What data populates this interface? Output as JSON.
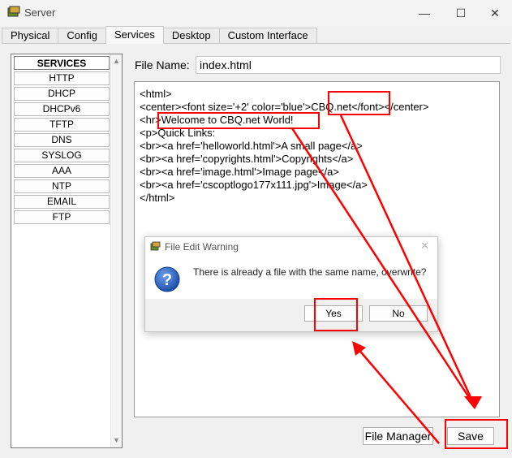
{
  "window": {
    "title": "Server",
    "controls": [
      "—",
      "☐",
      "✕"
    ]
  },
  "tabs": [
    {
      "label": "Physical",
      "active": false
    },
    {
      "label": "Config",
      "active": false
    },
    {
      "label": "Services",
      "active": true
    },
    {
      "label": "Desktop",
      "active": false
    },
    {
      "label": "Custom Interface",
      "active": false
    }
  ],
  "services": {
    "heading": "SERVICES",
    "items": [
      "HTTP",
      "DHCP",
      "DHCPv6",
      "TFTP",
      "DNS",
      "SYSLOG",
      "AAA",
      "NTP",
      "EMAIL",
      "FTP"
    ]
  },
  "file": {
    "name_label": "File Name:",
    "name_value": "index.html"
  },
  "editor": {
    "lines": [
      "<html>",
      "<center><font size='+2' color='blue'>CBQ.net</font></center>",
      "<hr>Welcome to CBQ.net World!",
      "<p>Quick Links:",
      "<br><a href='helloworld.html'>A small page</a>",
      "<br><a href='copyrights.html'>Copyrights</a>",
      "<br><a href='image.html'>Image page</a>",
      "<br><a href='cscoptlogo177x111.jpg'>Image</a>",
      "</html>"
    ]
  },
  "buttons": {
    "file_manager": "File Manager",
    "save": "Save"
  },
  "dialog": {
    "title": "File Edit Warning",
    "message": "There is already a file with the same name, overwrite?",
    "yes": "Yes",
    "no": "No",
    "close": "✕"
  },
  "colors": {
    "annotation": "#ff0000",
    "question_icon": "#2a5cb8"
  }
}
